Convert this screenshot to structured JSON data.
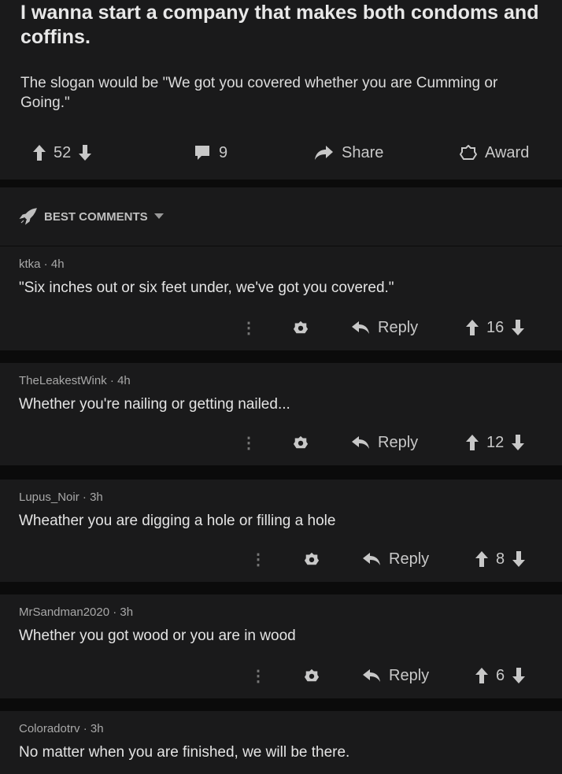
{
  "post": {
    "title": "I wanna start a company that makes both condoms and coffins.",
    "body": "The slogan would be \"We got you covered whether you are Cumming or Going.\"",
    "upvotes": "52",
    "comments_count": "9",
    "share_label": "Share",
    "award_label": "Award"
  },
  "sort": {
    "label": "BEST COMMENTS"
  },
  "comments": [
    {
      "author": "ktka",
      "age": "4h",
      "text": "\"Six inches out or six feet under, we've got you covered.\"",
      "reply_label": "Reply",
      "score": "16"
    },
    {
      "author": "TheLeakestWink",
      "age": "4h",
      "text": "Whether you're nailing or getting nailed...",
      "reply_label": "Reply",
      "score": "12"
    },
    {
      "author": "Lupus_Noir",
      "age": "3h",
      "text": "Wheather you are digging a hole or filling a hole",
      "reply_label": "Reply",
      "score": "8"
    },
    {
      "author": "MrSandman2020",
      "age": "3h",
      "text": "Whether you got wood or you are in wood",
      "reply_label": "Reply",
      "score": "6"
    },
    {
      "author": "Coloradotrv",
      "age": "3h",
      "text": "No matter when you are finished, we will be there."
    }
  ],
  "icons": {
    "upvote": "arrow-up-icon",
    "downvote": "arrow-down-icon",
    "comment": "comment-bubble-icon",
    "share": "share-arrow-icon",
    "award": "award-icon",
    "rocket": "rocket-icon",
    "more": "kebab-menu-icon",
    "reply": "reply-arrow-icon"
  },
  "colors": {
    "background": "#141414",
    "card": "#1a1a1b",
    "text": "#d7dadc"
  }
}
